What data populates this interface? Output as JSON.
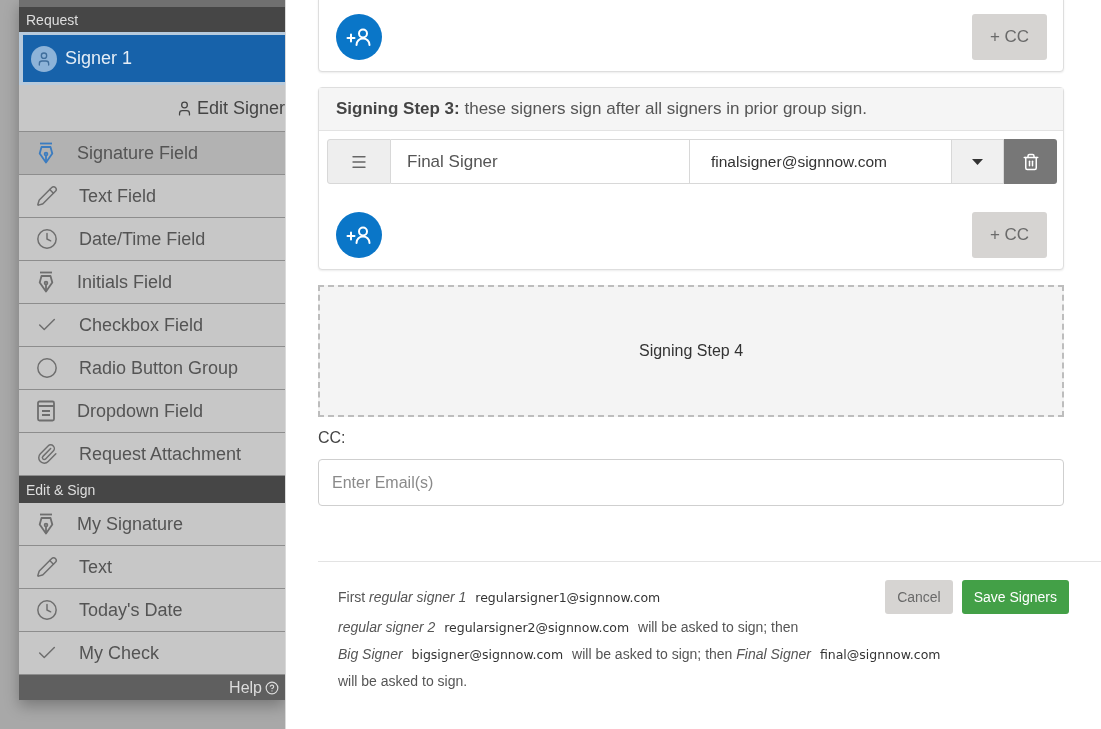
{
  "sidebar": {
    "sections": [
      {
        "title": "Request",
        "signer": {
          "name": "Signer 1"
        },
        "edit_link": "Edit Signer",
        "items": [
          {
            "label": "Signature Field",
            "selected": true
          },
          {
            "label": "Text Field",
            "selected": false
          },
          {
            "label": "Date/Time Field",
            "selected": false
          },
          {
            "label": "Initials Field",
            "selected": false
          },
          {
            "label": "Checkbox Field",
            "selected": false
          },
          {
            "label": "Radio Button Group",
            "selected": false
          },
          {
            "label": "Dropdown Field",
            "selected": false
          },
          {
            "label": "Request Attachment",
            "selected": false
          }
        ]
      },
      {
        "title": "Edit & Sign",
        "items": [
          {
            "label": "My Signature",
            "selected": false
          },
          {
            "label": "Text",
            "selected": false
          },
          {
            "label": "Today's Date",
            "selected": false
          },
          {
            "label": "My Check",
            "selected": false
          }
        ]
      }
    ],
    "help": "Help"
  },
  "signers_dialog": {
    "steps": [
      {
        "cc_button": {
          "label": "+ CC",
          "disabled": true
        }
      },
      {
        "heading": "**Signing Step 3:** these signers sign after all signers in prior group sign.",
        "signers": [
          {
            "name": "Final Signer",
            "email": "finalsigner@signnow.com"
          }
        ],
        "cc_button": {
          "label": "+ CC",
          "disabled": true
        }
      }
    ],
    "empty_step": "Signing Step 4",
    "cc": {
      "label": "CC:",
      "placeholder": "Enter Email(s)"
    },
    "summary": {
      "lines": [
        [
          {
            "kind": "text",
            "text": "First"
          },
          {
            "kind": "name",
            "text": "regular signer 1"
          },
          {
            "kind": "email",
            "text": "regularsigner1@signnow.com"
          }
        ],
        [
          {
            "kind": "name",
            "text": "regular signer 2"
          },
          {
            "kind": "email",
            "text": "regularsigner2@signnow.com"
          },
          {
            "kind": "text",
            "text": "will be asked to sign; then"
          }
        ],
        [
          {
            "kind": "name",
            "text": "Big Signer"
          },
          {
            "kind": "email",
            "text": "bigsigner@signnow.com"
          },
          {
            "kind": "text",
            "text": "will be asked to sign; then"
          },
          {
            "kind": "name",
            "text": "Final Signer"
          },
          {
            "kind": "email",
            "text": "final@signnow.com"
          }
        ],
        [
          {
            "kind": "text",
            "text": "will be asked to sign."
          }
        ]
      ]
    },
    "buttons": [
      {
        "label": "Cancel",
        "kind": "secondary",
        "disabled": true
      },
      {
        "label": "Save Signers",
        "kind": "primary",
        "disabled": false
      }
    ]
  }
}
